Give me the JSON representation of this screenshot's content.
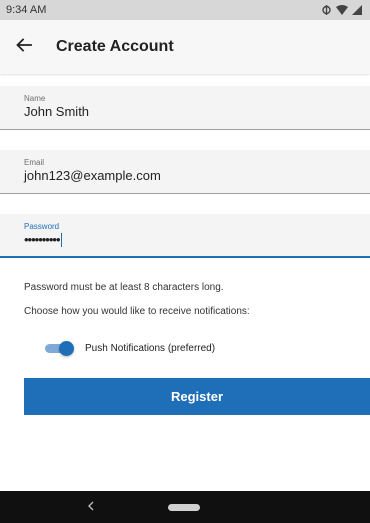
{
  "status_bar": {
    "time": "9:34 AM",
    "icons": [
      "vibrate-icon",
      "wifi-icon",
      "signal-icon"
    ]
  },
  "app_bar": {
    "title": "Create Account",
    "back_icon": "arrow-left-icon"
  },
  "form": {
    "name": {
      "label": "Name",
      "value": "John Smith"
    },
    "email": {
      "label": "Email",
      "value": "john123@example.com"
    },
    "password": {
      "label": "Password",
      "value": "••••••••••"
    }
  },
  "helper_text": "Password must be at least 8 characters long.",
  "notification_prompt": "Choose how you would like to receive notifications:",
  "push_switch": {
    "label": "Push Notifications (preferred)",
    "checked": true
  },
  "register_button": {
    "label": "Register"
  },
  "nav_bar": {
    "back_icon": "chevron-left-icon",
    "home_icon": "home-pill-icon"
  },
  "colors": {
    "accent": "#1f6fb8",
    "status_bar": "#d7d7d7",
    "field_bg": "#f4f4f4",
    "nav_bar": "#101010"
  }
}
